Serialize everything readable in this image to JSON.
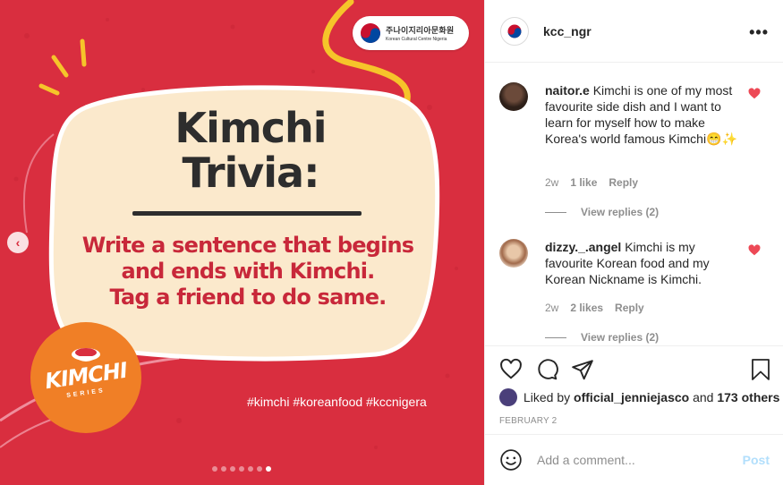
{
  "post": {
    "logo": {
      "ko": "주나이지리아문화원",
      "en": "Korean Cultural Centre Nigeria"
    },
    "title_lines": [
      "Kimchi",
      "Trivia:"
    ],
    "sub_lines": [
      "Write a sentence that begins",
      "and ends with Kimchi.",
      "Tag a friend to do same."
    ],
    "badge": {
      "title": "KIMCHI",
      "sub": "SERIES"
    },
    "hashtags": "#kimchi #koreanfood #kccnigera",
    "prev_glyph": "‹",
    "slide_count": 7,
    "active_slide": 7
  },
  "header": {
    "username": "kcc_ngr",
    "more_glyph": "•••"
  },
  "comments": [
    {
      "username": "naitor.e",
      "text": "Kimchi is one of my most favourite side dish and I want to learn for myself how to make Korea's world famous Kimchi😁✨",
      "age": "2w",
      "likes": "1 like",
      "reply": "Reply",
      "view_replies": "View replies (2)",
      "liked": true
    },
    {
      "username": "dizzy._.angel",
      "text": "Kimchi is my favourite Korean food and my Korean Nickname is Kimchi.",
      "age": "2w",
      "likes": "2 likes",
      "reply": "Reply",
      "view_replies": "View replies (2)",
      "liked": true
    }
  ],
  "likes": {
    "prefix": "Liked by ",
    "user": "official_jenniejasco",
    "middle": " and ",
    "count": "173 others"
  },
  "date": "FEBRUARY 2",
  "comment_box": {
    "placeholder": "Add a comment...",
    "post_label": "Post"
  },
  "colors": {
    "post_bg": "#d92e3f",
    "heart": "#ed4956",
    "badge": "#f07f26",
    "post_link": "#b2dffc"
  }
}
